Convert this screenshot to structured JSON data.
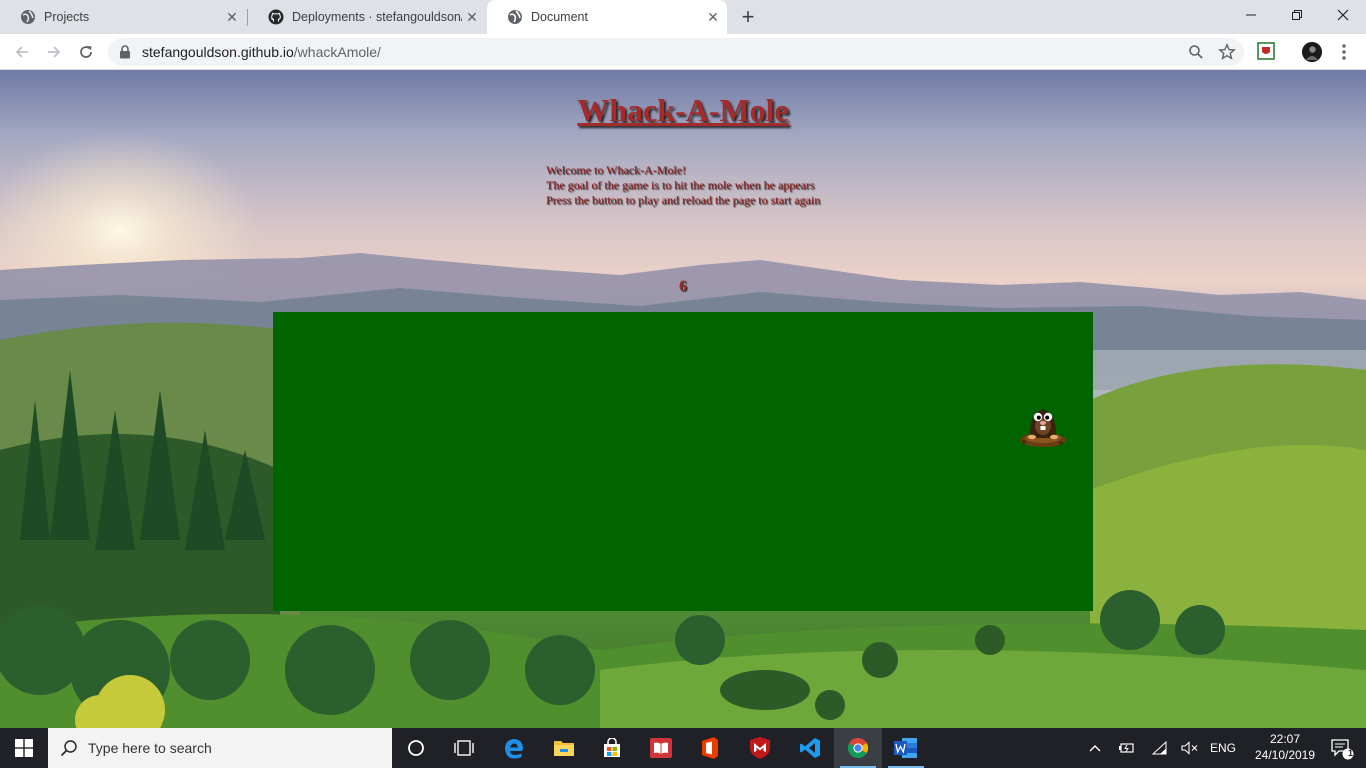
{
  "browser": {
    "tabs": [
      {
        "title": "Projects",
        "active": false
      },
      {
        "title": "Deployments · stefangouldson/w",
        "active": false
      },
      {
        "title": "Document",
        "active": true
      }
    ],
    "url_host": "stefangouldson.github.io",
    "url_path": "/whackAmole/"
  },
  "page": {
    "heading": "Whack-A-Mole",
    "intro_lines": [
      "Welcome to Whack-A-Mole!",
      "The goal of the game is to hit the mole when he appears",
      "Press the button to play and reload the page to start again"
    ],
    "score": "6",
    "board_color": "#006400",
    "heading_color": "#a52a2a"
  },
  "taskbar": {
    "search_placeholder": "Type here to search",
    "language": "ENG",
    "time": "22:07",
    "date": "24/10/2019",
    "notification_count": "1",
    "pinned_apps": [
      "cortana-icon",
      "task-view-icon",
      "edge-icon",
      "file-explorer-icon",
      "store-icon",
      "reader-icon",
      "office-icon",
      "mcafee-icon",
      "vscode-icon",
      "chrome-icon",
      "word-icon"
    ]
  }
}
